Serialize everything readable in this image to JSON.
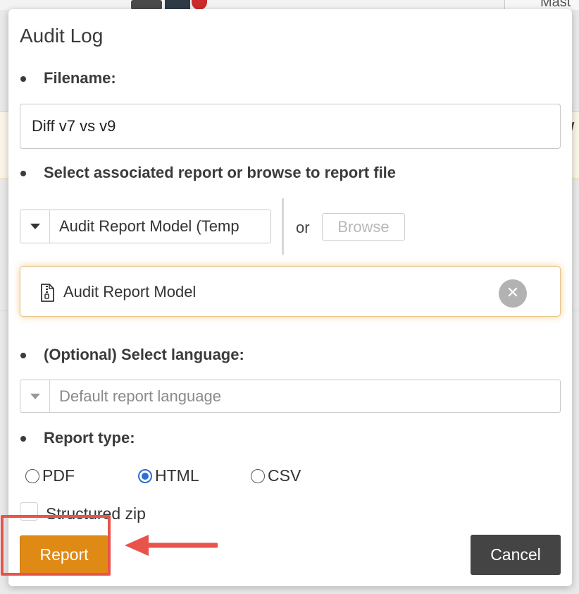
{
  "background": {
    "tab_text": "Mast",
    "slash": "/"
  },
  "dialog": {
    "title": "Audit Log",
    "filename": {
      "label": "Filename:",
      "value": "Diff v7 vs v9"
    },
    "report_select": {
      "label": "Select associated report or browse to report file",
      "selected": "Audit Report Model (Temp",
      "or_text": "or",
      "browse_label": "Browse"
    },
    "selected_file": {
      "name": "Audit Report Model",
      "icon": "zip-file-icon",
      "clear_icon": "close-icon"
    },
    "language": {
      "label": "(Optional) Select language:",
      "placeholder": "Default report language"
    },
    "report_type": {
      "label": "Report type:",
      "options": [
        {
          "label": "PDF",
          "checked": false
        },
        {
          "label": "HTML",
          "checked": true
        },
        {
          "label": "CSV",
          "checked": false
        }
      ]
    },
    "structured_zip": {
      "label": "Structured zip",
      "checked": false
    },
    "buttons": {
      "report": "Report",
      "cancel": "Cancel"
    }
  },
  "colors": {
    "primary_button": "#e08a16",
    "cancel_button": "#444444",
    "radio_checked": "#2f6fd1",
    "annotation": "#e8534c"
  }
}
